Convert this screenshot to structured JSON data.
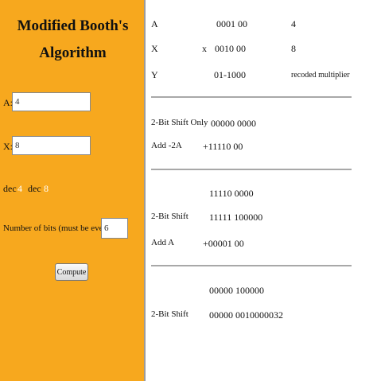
{
  "sidebar": {
    "title_line1": "Modified Booth's",
    "title_line2": "Algorithm",
    "a_label": "A:",
    "a_value": "4",
    "x_label": "X:",
    "x_value": "8",
    "dec_label_1": "dec",
    "dec_value_1": "4",
    "dec_label_2": "dec",
    "dec_value_2": "8",
    "bits_label": "Number of bits (must be even)",
    "bits_value": "6",
    "compute_label": "Compute",
    "colors": {
      "background": "#f7a81e"
    }
  },
  "result": {
    "header": {
      "a_label": "A",
      "a_bits": "0001 00",
      "a_dec": "4",
      "x_label": "X",
      "x_mult": "x",
      "x_bits": "0010 00",
      "x_dec": "8",
      "y_label": "Y",
      "y_bits": "01-1000",
      "y_desc": "recoded multiplier"
    },
    "step1": {
      "row1_label": "2-Bit Shift Only",
      "row1_bits": "00000 0000",
      "row2_label": "Add -2A",
      "row2_bits": "+11110 00"
    },
    "step2": {
      "row1_bits": "11110 0000",
      "row2_label": "2-Bit Shift",
      "row2_bits": "11111 100000",
      "row3_label": "Add A",
      "row3_bits": "+00001 00"
    },
    "step3": {
      "row1_bits": "00000 100000",
      "row2_label": "2-Bit Shift",
      "row2_bits": "00000 0010000032"
    }
  }
}
